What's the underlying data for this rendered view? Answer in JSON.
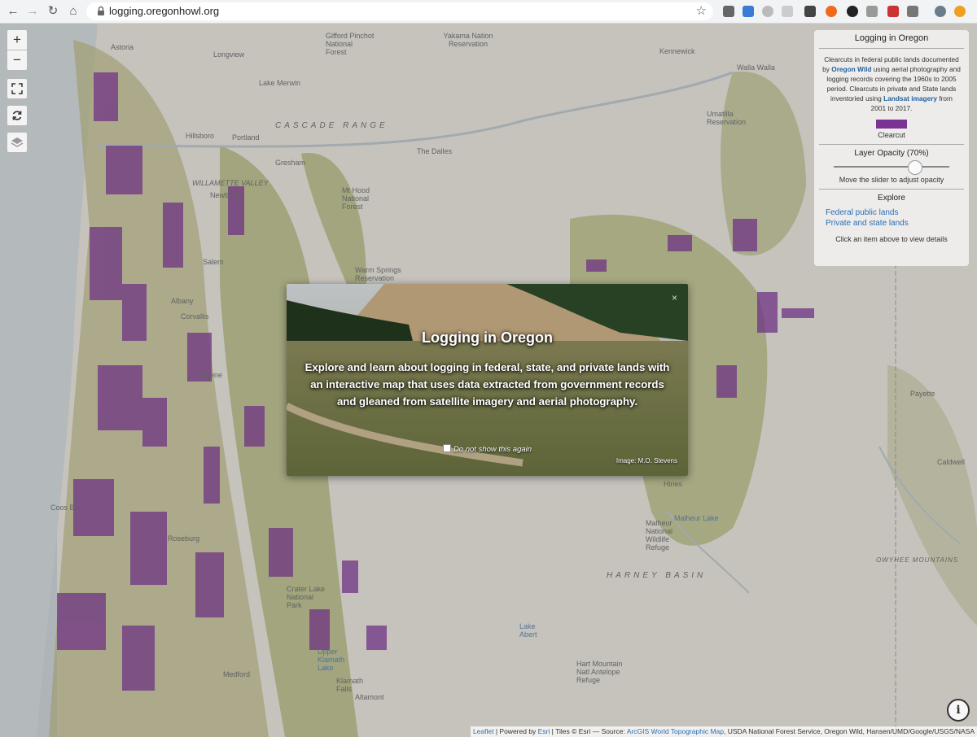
{
  "browser": {
    "url": "logging.oregonhowl.org",
    "back_icon": "arrow-left-icon",
    "forward_icon": "arrow-right-icon",
    "reload_icon": "reload-icon",
    "home_icon": "home-icon"
  },
  "map_labels": [
    {
      "text": "Astoria"
    },
    {
      "text": "Longview"
    },
    {
      "text": "Gifford Pinchot National Forest"
    },
    {
      "text": "Yakama Nation Reservation"
    },
    {
      "text": "Kennewick"
    },
    {
      "text": "Walla Walla"
    },
    {
      "text": "Lake Merwin"
    },
    {
      "text": "CASCADE RANGE"
    },
    {
      "text": "Hillsboro"
    },
    {
      "text": "Portland"
    },
    {
      "text": "Gresham"
    },
    {
      "text": "The Dalles"
    },
    {
      "text": "Umatilla Reservation"
    },
    {
      "text": "WILLAMETTE VALLEY"
    },
    {
      "text": "Newberg"
    },
    {
      "text": "Mt Hood National Forest"
    },
    {
      "text": "Salem"
    },
    {
      "text": "Warm Springs Reservation"
    },
    {
      "text": "Albany"
    },
    {
      "text": "Corvallis"
    },
    {
      "text": "Eugene"
    },
    {
      "text": "Coos Bay"
    },
    {
      "text": "Roseburg"
    },
    {
      "text": "Crater Lake National Park"
    },
    {
      "text": "HARNEY BASIN"
    },
    {
      "text": "Malheur Lake"
    },
    {
      "text": "Malheur National Wildlife Refuge"
    },
    {
      "text": "Hines"
    },
    {
      "text": "Payette"
    },
    {
      "text": "Caldwell"
    },
    {
      "text": "OWYHEE MOUNTAINS"
    },
    {
      "text": "Lake Abert"
    },
    {
      "text": "Medford"
    },
    {
      "text": "Klamath Falls"
    },
    {
      "text": "Altamont"
    },
    {
      "text": "Hart Mountain Natl Antelope Refuge"
    },
    {
      "text": "Upper Klamath Lake"
    }
  ],
  "controls": {
    "zoom_in": "+",
    "zoom_out": "−"
  },
  "panel": {
    "title": "Logging in Oregon",
    "desc_1": "Clearcuts in federal public lands documented by ",
    "desc_link_1": "Oregon Wild",
    "desc_2": " using aerial photography and logging records covering the 1960s to 2005 period. Clearcuts in private and State lands inventoried using ",
    "desc_link_2": "Landsat imagery",
    "desc_3": " from 2001 to 2017.",
    "legend_label": "Clearcut",
    "legend_color": "#7b3294",
    "opacity_title": "Layer Opacity (70%)",
    "opacity_value": 0.7,
    "opacity_hint": "Move the slider to adjust opacity",
    "explore_title": "Explore",
    "explore_items": [
      "Federal public lands",
      "Private and state lands"
    ],
    "explore_hint": "Click an item above to view details"
  },
  "modal": {
    "title": "Logging in Oregon",
    "body": "Explore and learn about logging in federal, state, and private lands with an interactive map that uses data extracted from government records and gleaned from satellite imagery and aerial photography.",
    "checkbox_label": "Do not show this again",
    "credit": "Image: M.O. Stevens",
    "close_label": "×"
  },
  "info_button": "i",
  "attribution": {
    "leaflet": "Leaflet",
    "sep1": " | Powered by ",
    "esri": "Esri",
    "sep2": " | Tiles © Esri — Source: ",
    "source_link": "ArcGIS World Topographic Map",
    "rest": ", USDA National Forest Service, Oregon Wild, Hansen/UMD/Google/USGS/NASA"
  },
  "colors": {
    "clearcut": "#7b3294",
    "forest": "#a7ad6b",
    "accent_link": "#2a6fb5"
  }
}
